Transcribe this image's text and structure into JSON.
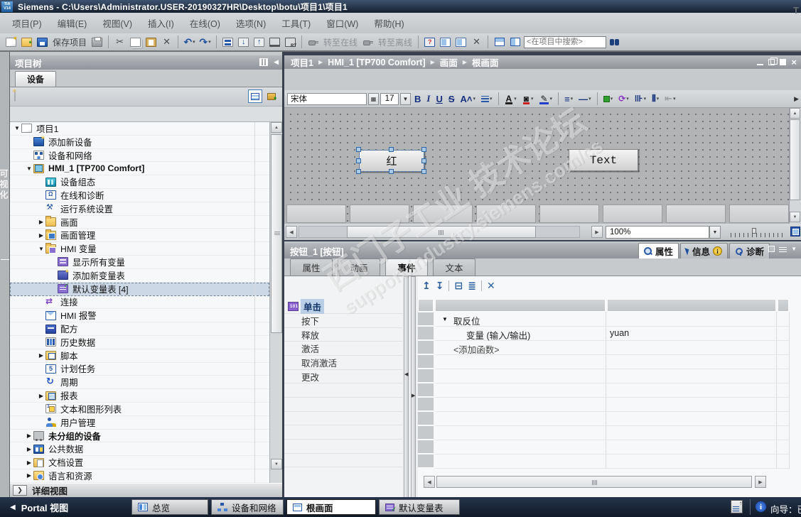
{
  "titlebar": {
    "logo_top": "TIA",
    "logo_bottom": "V14",
    "title": "Siemens  -  C:\\Users\\Administrator.USER-20190327HR\\Desktop\\botu\\项目1\\项目1"
  },
  "menubar": {
    "items": [
      "项目(P)",
      "编辑(E)",
      "视图(V)",
      "插入(I)",
      "在线(O)",
      "选项(N)",
      "工具(T)",
      "窗口(W)",
      "帮助(H)"
    ],
    "right_clip": "T"
  },
  "toolbar": {
    "save_label": "保存项目",
    "go_online_label": "转至在线",
    "go_offline_label": "转至离线",
    "search_placeholder": "<在项目中搜索>"
  },
  "left_strip": {
    "label": "可视化"
  },
  "project_tree": {
    "header": "项目树",
    "tab": "设备",
    "items": [
      {
        "depth": 0,
        "expander": "▼",
        "icon": "project",
        "label": "项目1"
      },
      {
        "depth": 1,
        "expander": "",
        "icon": "add-device",
        "label": "添加新设备"
      },
      {
        "depth": 1,
        "expander": "",
        "icon": "network",
        "label": "设备和网络"
      },
      {
        "depth": 1,
        "expander": "▼",
        "icon": "hmi-device",
        "label": "HMI_1 [TP700 Comfort]",
        "bold": true
      },
      {
        "depth": 2,
        "expander": "",
        "icon": "device-config",
        "label": "设备组态"
      },
      {
        "depth": 2,
        "expander": "",
        "icon": "online-diag",
        "label": "在线和诊断"
      },
      {
        "depth": 2,
        "expander": "",
        "icon": "runtime",
        "label": "运行系统设置"
      },
      {
        "depth": 2,
        "expander": "▶",
        "icon": "folder",
        "label": "画面"
      },
      {
        "depth": 2,
        "expander": "▶",
        "icon": "folder-screen",
        "label": "画面管理"
      },
      {
        "depth": 2,
        "expander": "▼",
        "icon": "folder-tags",
        "label": "HMI 变量"
      },
      {
        "depth": 3,
        "expander": "",
        "icon": "show-tags",
        "label": "显示所有变量"
      },
      {
        "depth": 3,
        "expander": "",
        "icon": "add-tag-table",
        "label": "添加新变量表"
      },
      {
        "depth": 3,
        "expander": "",
        "icon": "tag-table",
        "label": "默认变量表 [4]",
        "selected": true
      },
      {
        "depth": 2,
        "expander": "",
        "icon": "connections",
        "label": "连接"
      },
      {
        "depth": 2,
        "expander": "",
        "icon": "alarms",
        "label": "HMI 报警"
      },
      {
        "depth": 2,
        "expander": "",
        "icon": "recipes",
        "label": "配方"
      },
      {
        "depth": 2,
        "expander": "",
        "icon": "history",
        "label": "历史数据"
      },
      {
        "depth": 2,
        "expander": "▶",
        "icon": "scripts",
        "label": "脚本"
      },
      {
        "depth": 2,
        "expander": "",
        "icon": "scheduler",
        "label": "计划任务"
      },
      {
        "depth": 2,
        "expander": "",
        "icon": "cycles",
        "label": "周期"
      },
      {
        "depth": 2,
        "expander": "▶",
        "icon": "reports",
        "label": "报表"
      },
      {
        "depth": 2,
        "expander": "",
        "icon": "text-lists",
        "label": "文本和图形列表"
      },
      {
        "depth": 2,
        "expander": "",
        "icon": "user-admin",
        "label": "用户管理"
      },
      {
        "depth": 1,
        "expander": "▶",
        "icon": "ungrouped",
        "label": "未分组的设备",
        "bold": true
      },
      {
        "depth": 1,
        "expander": "▶",
        "icon": "common-data",
        "label": "公共数据"
      },
      {
        "depth": 1,
        "expander": "▶",
        "icon": "doc-settings",
        "label": "文档设置"
      },
      {
        "depth": 1,
        "expander": "▶",
        "icon": "languages",
        "label": "语言和资源"
      }
    ]
  },
  "details_view": {
    "label": "详细视图"
  },
  "breadcrumb": {
    "segments": [
      "项目1",
      "HMI_1 [TP700 Comfort]",
      "画面",
      "根画面"
    ]
  },
  "editor": {
    "font_family": "宋体",
    "font_size": "17",
    "zoom_value": "100%",
    "canvas_objects": [
      {
        "type": "button",
        "label": "红",
        "selected": true
      },
      {
        "type": "button",
        "label": "Text",
        "selected": false
      }
    ]
  },
  "properties": {
    "title": "按钮_1 [按钮]",
    "view_tabs": [
      {
        "label": "属性",
        "icon": "magnifier-icon",
        "active": true
      },
      {
        "label": "信息",
        "icon": "info-icon",
        "badge": "i",
        "active": false
      },
      {
        "label": "诊断",
        "icon": "diagnostics-icon",
        "active": false
      }
    ],
    "tabs": [
      {
        "label": "属性"
      },
      {
        "label": "动画"
      },
      {
        "label": "事件",
        "active": true
      },
      {
        "label": "文本"
      }
    ],
    "events": [
      {
        "label": "单击",
        "selected": true
      },
      {
        "label": "按下"
      },
      {
        "label": "释放"
      },
      {
        "label": "激活"
      },
      {
        "label": "取消激活"
      },
      {
        "label": "更改"
      }
    ],
    "function_table": {
      "rows": [
        {
          "kind": "group",
          "label": "取反位",
          "expanded": true
        },
        {
          "kind": "param",
          "label": "变量 (输入/输出)",
          "value": "yuan"
        },
        {
          "kind": "add",
          "label": "<添加函数>"
        }
      ]
    }
  },
  "taskbar": {
    "portal_label": "Portal 视图",
    "buttons": [
      {
        "label": "总览",
        "icon": "overview"
      },
      {
        "label": "设备和网络",
        "icon": "network"
      },
      {
        "label": "根画面",
        "icon": "screen",
        "active": true
      },
      {
        "label": "默认变量表",
        "icon": "tagtable"
      }
    ],
    "status": "向导：已"
  },
  "watermark": {
    "line1": "西门子工业 技术论坛",
    "line2": "support.industry.siemens.com/cs"
  }
}
